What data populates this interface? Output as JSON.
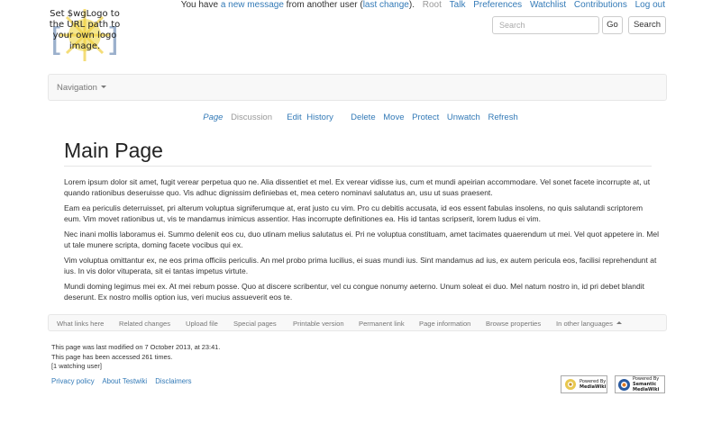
{
  "logo": {
    "text": "Set $wgLogo to the URL path to your own logo image."
  },
  "personal": {
    "prefix": "You have ",
    "new_message": "a new message",
    "middle": " from another user (",
    "last_change": "last change",
    "suffix": ").",
    "root": "Root",
    "talk": "Talk",
    "preferences": "Preferences",
    "watchlist": "Watchlist",
    "contributions": "Contributions",
    "logout": "Log out"
  },
  "search": {
    "placeholder": "Search",
    "go": "Go",
    "search": "Search"
  },
  "navbar": {
    "navigation": "Navigation"
  },
  "actions": {
    "page": "Page",
    "discussion": "Discussion",
    "edit": "Edit",
    "history": "History",
    "delete": "Delete",
    "move": "Move",
    "protect": "Protect",
    "unwatch": "Unwatch",
    "refresh": "Refresh"
  },
  "title": "Main Page",
  "paragraphs": [
    "Lorem ipsum dolor sit amet, fugit verear perpetua quo ne. Alia dissentiet et mel. Ex verear vidisse ius, cum et mundi apeirian accommodare. Vel sonet facete incorrupte at, ut quando rationibus deseruisse quo. Vis adhuc dignissim definiebas et, mea cetero nominavi salutatus an, usu ut suas praesent.",
    "Eam ea periculis deterruisset, pri alterum voluptua signiferumque at, erat justo cu vim. Pro cu debitis accusata, id eos essent fabulas insolens, no quis salutandi scriptorem eum. Vim movet rationibus ut, vis te mandamus inimicus assentior. Has incorrupte definitiones ea. His id tantas scripserit, lorem ludus ei vim.",
    "Nec inani mollis laboramus ei. Summo delenit eos cu, duo utinam melius salutatus ei. Pri ne voluptua constituam, amet tacimates quaerendum ut mei. Vel quot appetere in. Mel ut tale munere scripta, doming facete vocibus qui ex.",
    "Vim voluptua omittantur ex, ne eos prima officiis periculis. An mel probo prima lucilius, ei suas mundi ius. Sint mandamus ad ius, ex autem pericula eos, facilisi reprehendunt at ius. In vis dolor vituperata, sit ei tantas impetus virtute.",
    "Mundi doming legimus mei ex. At mei rebum posse. Quo at discere scribentur, vel cu congue nonumy aeterno. Unum soleat ei duo. Mel natum nostro in, id pri debet blandit deserunt. Ex nostro mollis option ius, veri mucius assueverit eos te."
  ],
  "footer_bar": {
    "what_links_here": "What links here",
    "related_changes": "Related changes",
    "upload_file": "Upload file",
    "special_pages": "Special pages",
    "printable_version": "Printable version",
    "permanent_link": "Permanent link",
    "page_information": "Page information",
    "browse_properties": "Browse properties",
    "other_languages": "In other languages"
  },
  "footer_info": {
    "last_modified": "This page was last modified on 7 October 2013, at 23:41.",
    "accessed": "This page has been accessed 261 times.",
    "watching": "[1 watching user]"
  },
  "footer_links": {
    "privacy": "Privacy policy",
    "about": "About Testwiki",
    "disclaimers": "Disclaimers"
  },
  "badges": {
    "mediawiki_line1": "Powered By",
    "mediawiki_line2": "MediaWiki",
    "smw_line1": "Powered By",
    "smw_line2": "Semantic",
    "smw_line3": "MediaWiki"
  }
}
